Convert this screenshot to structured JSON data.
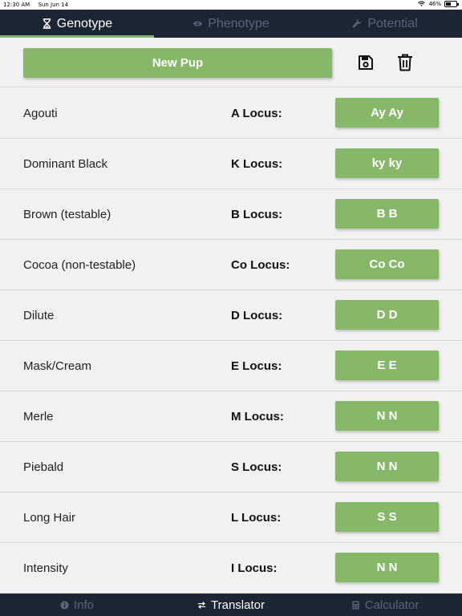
{
  "status_bar": {
    "time": "12:30 AM",
    "date": "Sun Jun 14",
    "battery": "46%",
    "battery_level": 0.46
  },
  "top_tabs": [
    {
      "label": "Genotype",
      "icon": "hourglass-icon",
      "active": true
    },
    {
      "label": "Phenotype",
      "icon": "eye-icon",
      "active": false
    },
    {
      "label": "Potential",
      "icon": "wrench-icon",
      "active": false
    }
  ],
  "toolbar": {
    "new_pup_label": "New Pup",
    "save_icon": "save-icon",
    "delete_icon": "trash-icon"
  },
  "loci": [
    {
      "trait": "Agouti",
      "locus": "A Locus:",
      "alleles": "Ay Ay"
    },
    {
      "trait": "Dominant Black",
      "locus": "K Locus:",
      "alleles": "ky ky"
    },
    {
      "trait": "Brown (testable)",
      "locus": "B Locus:",
      "alleles": "B B"
    },
    {
      "trait": "Cocoa (non-testable)",
      "locus": "Co Locus:",
      "alleles": "Co Co"
    },
    {
      "trait": "Dilute",
      "locus": "D Locus:",
      "alleles": "D D"
    },
    {
      "trait": "Mask/Cream",
      "locus": "E Locus:",
      "alleles": "E E"
    },
    {
      "trait": "Merle",
      "locus": "M Locus:",
      "alleles": "N N"
    },
    {
      "trait": "Piebald",
      "locus": "S Locus:",
      "alleles": "N N"
    },
    {
      "trait": "Long Hair",
      "locus": "L Locus:",
      "alleles": "S S"
    },
    {
      "trait": "Intensity",
      "locus": "I Locus:",
      "alleles": "N N"
    }
  ],
  "bottom_tabs": [
    {
      "label": "Info",
      "icon": "info-icon",
      "active": false
    },
    {
      "label": "Translator",
      "icon": "swap-arrows-icon",
      "active": true
    },
    {
      "label": "Calculator",
      "icon": "calculator-icon",
      "active": false
    }
  ],
  "colors": {
    "accent": "#87b86a",
    "nav_bg": "#1c2534",
    "nav_inactive": "#5a6578",
    "page_bg": "#f1f1f1"
  }
}
